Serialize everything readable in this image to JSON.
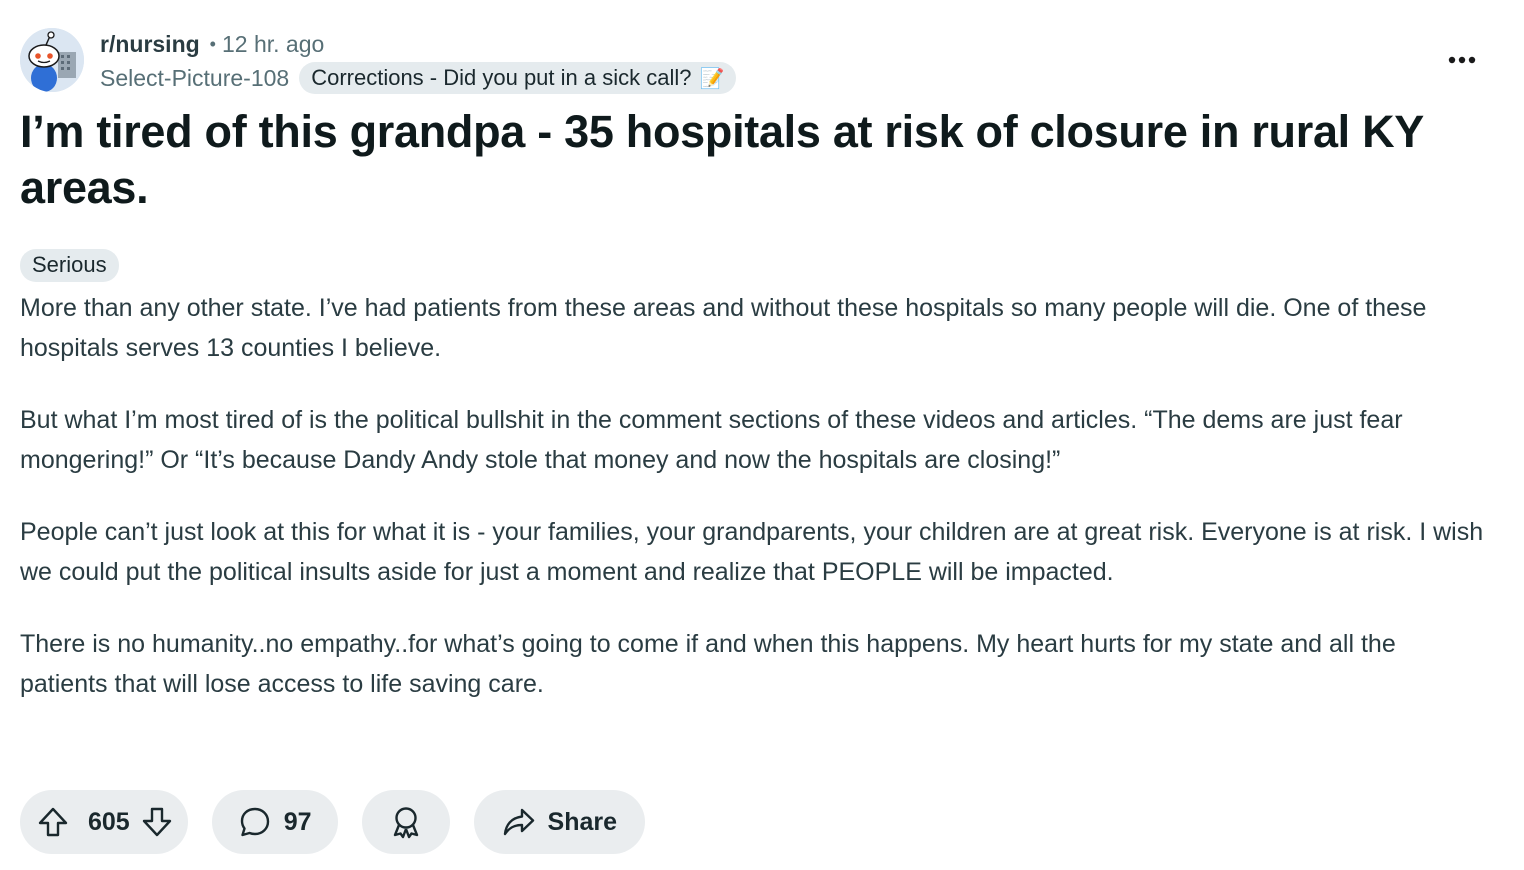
{
  "post": {
    "subreddit": "r/nursing",
    "separator": "•",
    "time_ago": "12 hr. ago",
    "username": "Select-Picture-108",
    "user_flair": {
      "text": "Corrections - Did you put in a sick call?",
      "emoji": "📝"
    },
    "title": "I’m tired of this grandpa - 35 hospitals at risk of closure in rural KY areas.",
    "post_flair": "Serious",
    "body": [
      "More than any other state. I’ve had patients from these areas and without these hospitals so many people will die. One of these hospitals serves 13 counties I believe.",
      "But what I’m most tired of is the political bullshit in the comment sections of these videos and articles. “The dems are just fear mongering!” Or “It’s because Dandy Andy stole that money and now the hospitals are closing!”",
      "People can’t just look at this for what it is - your families, your grandparents, your children are at great risk. Everyone is at risk. I wish we could put the political insults aside for just a moment and realize that PEOPLE will be impacted.",
      "There is no humanity..no empathy..for what’s going to come if and when this happens. My heart hurts for my state and all the patients that will lose access to life saving care."
    ]
  },
  "actions": {
    "vote_count": "605",
    "comment_count": "97",
    "share_label": "Share"
  },
  "icons": {
    "avatar": "snoo-avatar",
    "more": "more-options-icon",
    "upvote": "upvote-arrow-icon",
    "downvote": "downvote-arrow-icon",
    "comment": "comment-bubble-icon",
    "award": "award-icon",
    "share": "share-arrow-icon"
  },
  "colors": {
    "pill_background": "#eaedef",
    "flair_background": "#e5ebee",
    "text_primary": "#0f1a1c",
    "text_secondary": "#576f76"
  }
}
